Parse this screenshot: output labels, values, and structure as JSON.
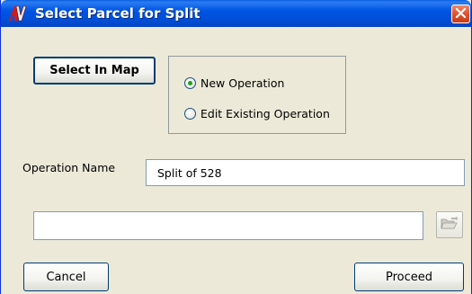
{
  "window": {
    "title": "Select Parcel for Split",
    "app_icon": "app-logo-icon",
    "close_icon": "close-icon"
  },
  "buttons": {
    "select_in_map": "Select In Map",
    "cancel": "Cancel",
    "proceed": "Proceed"
  },
  "operation": {
    "new_label": "New Operation",
    "new_selected": true,
    "edit_label": "Edit Existing Operation",
    "edit_selected": false
  },
  "operation_name": {
    "label": "Operation Name",
    "value": "Split of 528"
  },
  "file_path": {
    "value": "",
    "browse_icon": "folder-open-icon"
  },
  "colors": {
    "titlebar": "#0054e3",
    "window_bg": "#ece9d8",
    "close_button": "#e2552e",
    "radio_selected": "#21a121"
  }
}
